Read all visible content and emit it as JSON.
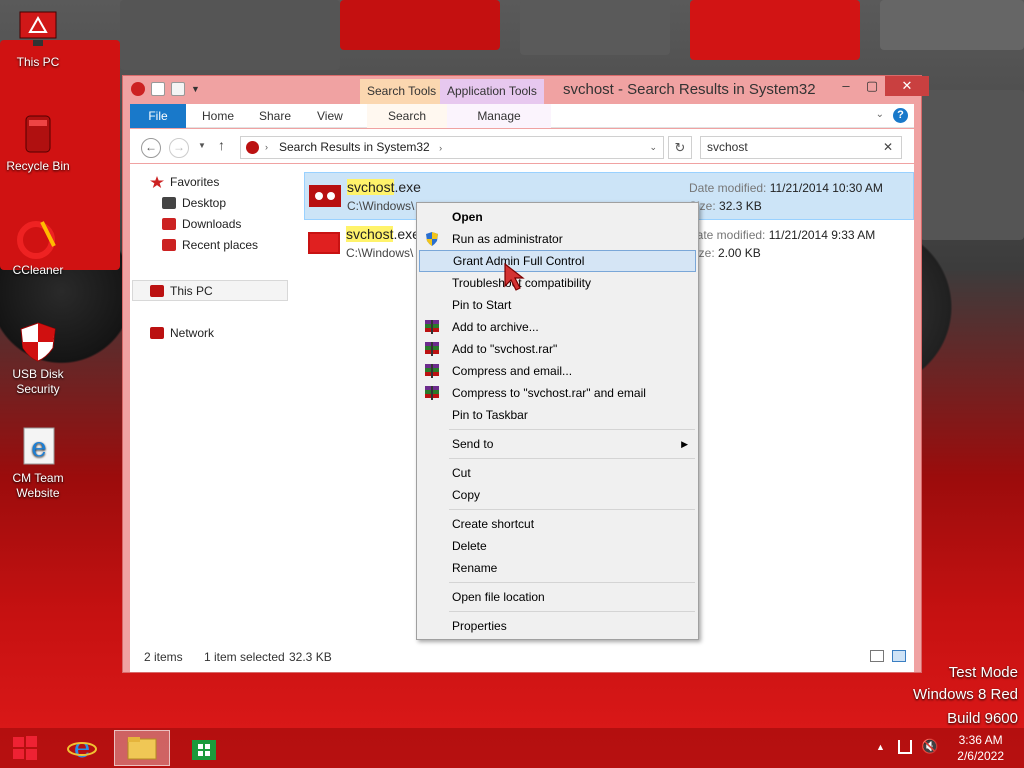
{
  "desktop": {
    "icons": [
      {
        "label": "This PC"
      },
      {
        "label": "Recycle Bin"
      },
      {
        "label": "CCleaner"
      },
      {
        "label": "USB Disk Security"
      },
      {
        "label": "CM Team Website"
      }
    ],
    "watermark": {
      "line1": "Test Mode",
      "line2": "Windows 8 Red",
      "line3": "Build 9600"
    }
  },
  "window": {
    "title": "svchost - Search Results in System32",
    "context_tabs": {
      "search_tools": "Search Tools",
      "application_tools": "Application Tools"
    },
    "ribbon_tabs": [
      "File",
      "Home",
      "Share",
      "View",
      "Search",
      "Manage"
    ],
    "address": "Search Results in System32",
    "search_value": "svchost",
    "nav": {
      "favorites": "Favorites",
      "desktop": "Desktop",
      "downloads": "Downloads",
      "recent": "Recent places",
      "this_pc": "This PC",
      "network": "Network"
    },
    "files": [
      {
        "name_hl": "svchost",
        "name_rest": ".exe",
        "path": "C:\\Windows\\",
        "date_label": "Date modified:",
        "date": "11/21/2014 10:30 AM",
        "size_label": "Size:",
        "size": "32.3 KB"
      },
      {
        "name_hl": "svchost",
        "name_rest": ".exe",
        "path": "C:\\Windows\\",
        "date_label": "Date modified:",
        "date": "11/21/2014 9:33 AM",
        "size_label": "Size:",
        "size": "2.00 KB"
      }
    ],
    "status": {
      "items": "2 items",
      "selected": "1 item selected",
      "size": "32.3 KB"
    }
  },
  "context_menu": {
    "items": [
      "Open",
      "Run as administrator",
      "Grant Admin Full Control",
      "Troubleshoot compatibility",
      "Pin to Start",
      "Add to archive...",
      "Add to \"svchost.rar\"",
      "Compress and email...",
      "Compress to \"svchost.rar\" and email",
      "Pin to Taskbar",
      "Send to",
      "Cut",
      "Copy",
      "Create shortcut",
      "Delete",
      "Rename",
      "Open file location",
      "Properties"
    ]
  },
  "taskbar": {
    "time": "3:36 AM",
    "date": "2/6/2022"
  },
  "colors": {
    "accent": "#1979ca",
    "window_frame": "#f0a2a2",
    "desktop_red": "#c61111"
  }
}
